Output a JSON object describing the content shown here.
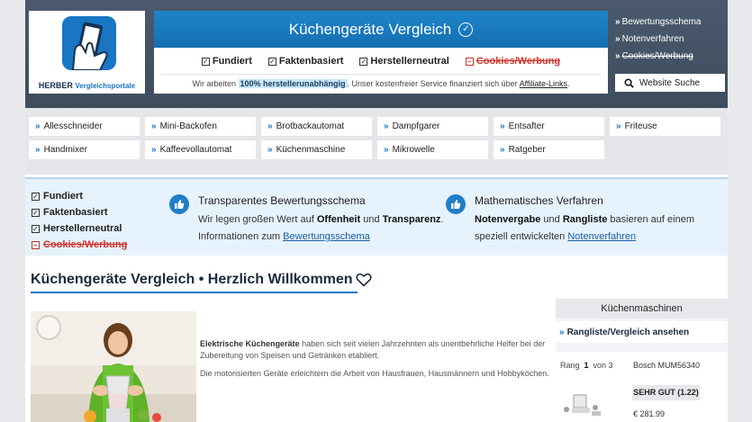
{
  "header": {
    "logo_brand": "HERBER",
    "logo_suffix": "Vergleichsportale",
    "title": "Küchengeräte Vergleich",
    "features": [
      {
        "label": "Fundiert",
        "negated": false
      },
      {
        "label": "Faktenbasiert",
        "negated": false
      },
      {
        "label": "Herstellerneutral",
        "negated": false
      },
      {
        "label": "Cookies/Werbung",
        "negated": true
      }
    ],
    "info_pre": "Wir arbeiten",
    "info_highlight": "100% herstellerunabhängig",
    "info_mid": ". Unser kostenfreier Service finanziert sich über",
    "info_link": "Affiliate-Links",
    "info_post": ".",
    "right_links": [
      {
        "label": "Bewertungsschema",
        "negated": false
      },
      {
        "label": "Notenverfahren",
        "negated": false
      },
      {
        "label": "Cookies/Werbung",
        "negated": true
      }
    ],
    "search_label": "Website Suche"
  },
  "nav": [
    "Allesschneider",
    "Mini-Backofen",
    "Brotbackautomat",
    "Dampfgarer",
    "Entsafter",
    "Friteuse",
    "Handmixer",
    "Kaffeevollautomat",
    "Küchenmaschine",
    "Mikrowelle",
    "Ratgeber"
  ],
  "strip": {
    "list": [
      {
        "label": "Fundiert",
        "negated": false
      },
      {
        "label": "Faktenbasiert",
        "negated": false
      },
      {
        "label": "Herstellerneutral",
        "negated": false
      },
      {
        "label": "Cookies/Werbung",
        "negated": true
      }
    ],
    "block1": {
      "title": "Transparentes Bewertungsschema",
      "l1_pre": "Wir legen großen Wert auf",
      "l1_b1": "Offenheit",
      "l1_mid": "und",
      "l1_b2": "Transparenz",
      "l1_post": ".",
      "l2_pre": "Informationen zum",
      "l2_link": "Bewertungsschema"
    },
    "block2": {
      "title": "Mathematisches Verfahren",
      "l1_b1": "Notenvergabe",
      "l1_mid": "und",
      "l1_b2": "Rangliste",
      "l1_post": "basieren auf einem",
      "l2_pre": "speziell entwickelten",
      "l2_link": "Notenverfahren"
    }
  },
  "main": {
    "title": "Küchengeräte Vergleich • Herzlich Willkommen",
    "intro_b": "Elektrische Küchengeräte",
    "intro_1": "haben sich seit vielen Jahrzehnten als unentbehrliche Helfer bei der Zubereitung von Speisen und Getränken etabliert.",
    "intro_2": "Die motorisierten Geräte erleichtern die Arbeit von Hausfrauen, Hausmännern und Hobbyköchen."
  },
  "sidebar": {
    "heading": "Küchenmaschinen",
    "link": "Rangliste/Vergleich ansehen",
    "rank_label": "Rang",
    "rank_value": "1",
    "rank_of": "von 3",
    "product": "Bosch MUM56340",
    "rating": "SEHR GUT (1.22)",
    "price": "€ 281.99"
  },
  "colors": {
    "accent": "#1976c4",
    "header_bg": "#3d4d5e",
    "negative": "#d0342c"
  }
}
